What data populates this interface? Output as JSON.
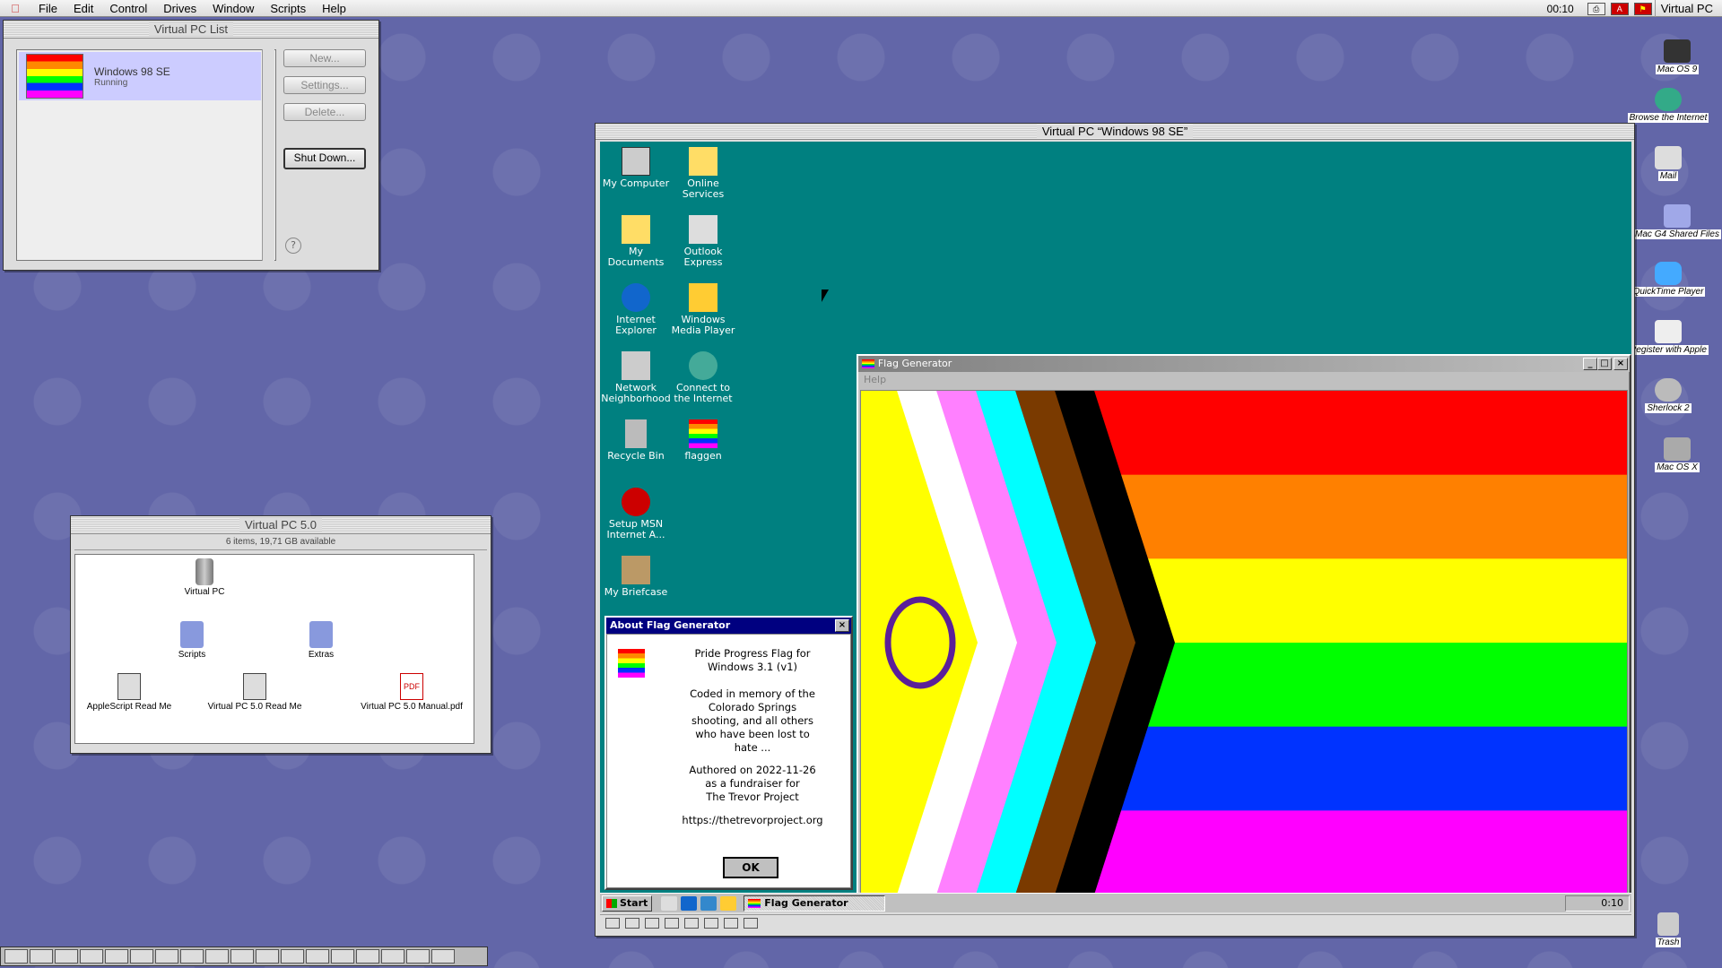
{
  "menubar": {
    "apple": "",
    "menus": [
      "File",
      "Edit",
      "Control",
      "Drives",
      "Window",
      "Scripts",
      "Help"
    ],
    "clock": "00:10",
    "app": "Virtual PC"
  },
  "vpclist": {
    "title": "Virtual PC List",
    "vm_name": "Windows 98 SE",
    "vm_status": "Running",
    "buttons": {
      "new": "New...",
      "settings": "Settings...",
      "delete": "Delete...",
      "shutdown": "Shut Down..."
    }
  },
  "finder": {
    "title": "Virtual PC 5.0",
    "info": "6 items, 19,71 GB available",
    "items": [
      "Virtual PC",
      "Scripts",
      "Extras",
      "AppleScript Read Me",
      "Virtual PC 5.0 Read Me",
      "Virtual PC 5.0 Manual.pdf"
    ]
  },
  "desktop_icons": [
    "Mac OS 9",
    "Browse the Internet",
    "Mail",
    "Mac G4 Shared Files",
    "QuickTime Player",
    "Register with Apple",
    "Sherlock 2",
    "Mac OS X",
    "Trash"
  ],
  "vpc": {
    "title": "Virtual PC “Windows 98 SE”",
    "icons": [
      {
        "label": "My Computer"
      },
      {
        "label": "Online Services"
      },
      {
        "label": "My Documents"
      },
      {
        "label": "Outlook Express"
      },
      {
        "label": "Internet Explorer"
      },
      {
        "label": "Windows Media Player"
      },
      {
        "label": "Network Neighborhood"
      },
      {
        "label": "Connect to the Internet"
      },
      {
        "label": "Recycle Bin"
      },
      {
        "label": "flaggen"
      },
      {
        "label": "Setup MSN Internet A..."
      },
      {
        "label": "My Briefcase"
      }
    ]
  },
  "flagwin": {
    "title": "Flag Generator",
    "menu": "Help",
    "stripes": [
      "#ff0000",
      "#ff8000",
      "#ffff00",
      "#00ff00",
      "#0033ff",
      "#ff00ff"
    ],
    "chevrons": [
      "#000000",
      "#7a3a00",
      "#00ffff",
      "#ff80ff",
      "#ffffff"
    ],
    "field": "#ffff00",
    "ring": "#5b1f99"
  },
  "about": {
    "title": "About Flag Generator",
    "line1": "Pride Progress Flag for",
    "line2": "Windows 3.1 (v1)",
    "memo": [
      "Coded in memory of the",
      "Colorado Springs",
      "shooting, and all others",
      "who have been lost to",
      "hate ..."
    ],
    "auth": [
      "Authored on 2022-11-26",
      "as a fundraiser for",
      "The Trevor Project"
    ],
    "url": "https://thetrevorproject.org",
    "ok": "OK"
  },
  "taskbar": {
    "start": "Start",
    "task": "Flag Generator",
    "time": "0:10"
  }
}
